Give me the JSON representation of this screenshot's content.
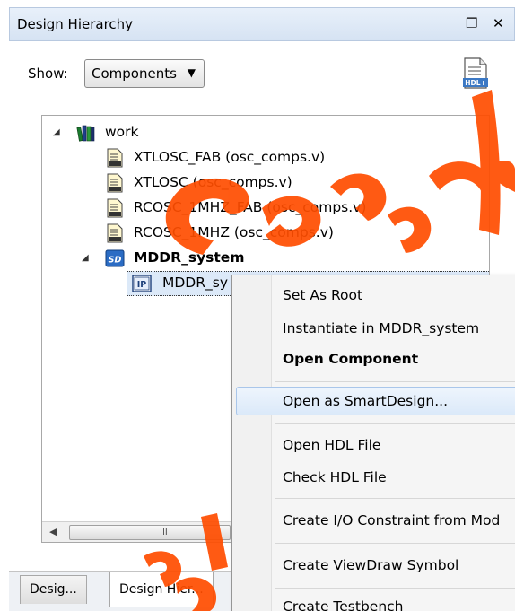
{
  "panel": {
    "title": "Design Hierarchy",
    "float_button": "❒",
    "close_button": "✕"
  },
  "toolbar": {
    "show_label": "Show:",
    "show_value": "Components",
    "hdl_icon_text": "HDL+"
  },
  "tree": {
    "root": {
      "label": "work",
      "expander": "◢"
    },
    "items": [
      {
        "label": "XTLOSC_FAB (osc_comps.v)",
        "icon": "hdl-file-icon"
      },
      {
        "label": "XTLOSC (osc_comps.v)",
        "icon": "hdl-file-icon"
      },
      {
        "label": "RCOSC_1MHZ_FAB (osc_comps.v)",
        "icon": "hdl-file-icon"
      },
      {
        "label": "RCOSC_1MHZ (osc_comps.v)",
        "icon": "hdl-file-icon"
      }
    ],
    "smartdesign": {
      "label": "MDDR_system",
      "icon_text": "SD",
      "expander": "◢"
    },
    "selected": {
      "label": "MDDR_sy",
      "icon_text": "IP"
    },
    "scrollbar_grip": "III",
    "scroll_left": "◀"
  },
  "context_menu": {
    "items": [
      {
        "label": "Set As Root",
        "bold": false
      },
      {
        "label": "Instantiate in MDDR_system",
        "bold": false
      },
      {
        "label": "Open Component",
        "bold": true
      },
      {
        "label": "Open as SmartDesign...",
        "bold": false,
        "highlighted": true
      },
      {
        "label": "Open HDL File",
        "bold": false
      },
      {
        "label": "Check HDL File",
        "bold": false
      },
      {
        "label": "Create I/O Constraint from Mod",
        "bold": false
      },
      {
        "label": "Create ViewDraw Symbol",
        "bold": false
      },
      {
        "label": "Create Testbench",
        "bold": false
      }
    ]
  },
  "bottom_tabs": [
    {
      "label": "Desig..."
    },
    {
      "label": "Design Hier..."
    }
  ],
  "colors": {
    "watermark": "#ff4d00",
    "selection": "#dce9f8",
    "menu_highlight": "#dbe9f9",
    "titlebar": "#d6e3f3"
  }
}
